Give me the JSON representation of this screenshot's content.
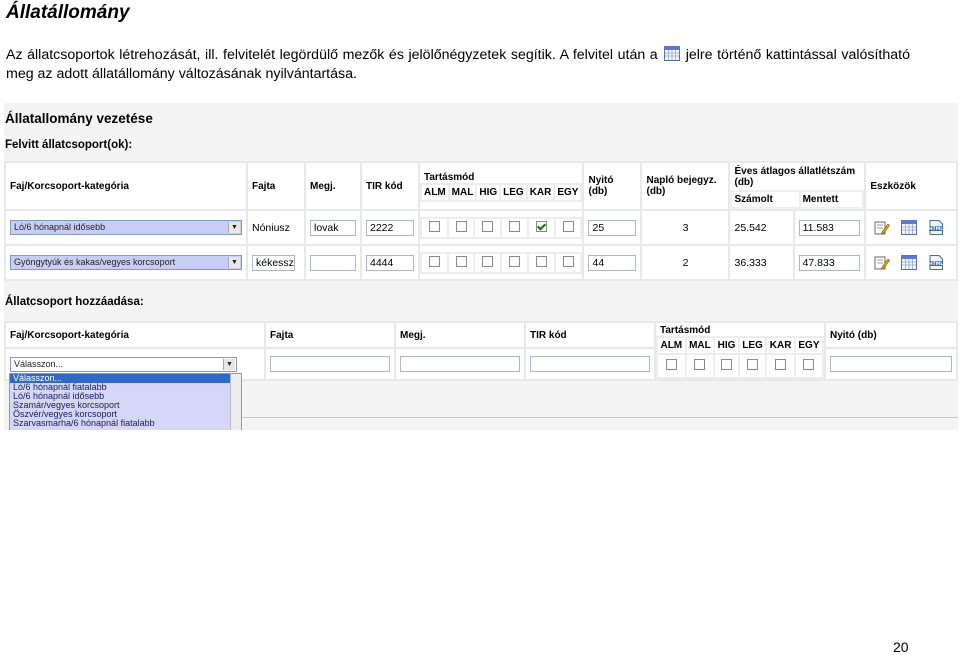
{
  "doc": {
    "title": "Állatállomány",
    "intro_part1": "Az állatcsoportok létrehozását, ill. felvitelét legördülő mezők és jelölőnégyzetek segítik. A felvitel után a",
    "intro_part2": "jelre történő kattintással valósítható meg az adott állatállomány változásának nyilvántartása.",
    "page_number": "20"
  },
  "screenshot": {
    "heading": "Állatallomány vezetése",
    "existing_heading": "Felvitt állatcsoport(ok):",
    "add_heading": "Állatcsoport hozzáadása:",
    "columns": {
      "category": "Faj/Korcsoport-kategória",
      "breed": "Fajta",
      "note": "Megj.",
      "tir": "TIR kód",
      "housing": "Tartásmód",
      "opening": "Nyitó (db)",
      "opening_two_line": [
        "Nyitó",
        "(db)"
      ],
      "log": "Napló bejegyz. (db)",
      "log_two_line": [
        "Napló bejegyz.",
        "(db)"
      ],
      "yearly": "Éves átlagos állatlétszám (db)",
      "yearly_two_line": [
        "Éves átlagos állatlétszám",
        "(db)"
      ],
      "calculated": "Számolt",
      "saved": "Mentett",
      "tools": "Eszközök"
    },
    "housing_codes": [
      "ALM",
      "MAL",
      "HIG",
      "LEG",
      "KAR",
      "EGY"
    ],
    "rows": [
      {
        "category": "Ló/6 hónapnál idősebb",
        "breed": "Nóniusz",
        "note": "lovak",
        "tir": "2222",
        "housing_checked": [
          false,
          false,
          false,
          false,
          true,
          false
        ],
        "opening": "25",
        "log": "3",
        "calculated": "25.542",
        "saved": "11.583"
      },
      {
        "category": "Gyöngytyúk és kakas/vegyes korcsoport",
        "breed": "kékesszü",
        "note": "",
        "tir": "4444",
        "housing_checked": [
          false,
          false,
          false,
          false,
          false,
          false
        ],
        "opening": "44",
        "log": "2",
        "calculated": "36.333",
        "saved": "47.833"
      }
    ],
    "add_form": {
      "category_selected": "Válasszon...",
      "dropdown_options": [
        "Válasszon...",
        "Ló/6 hónapnál fiatalabb",
        "Ló/6 hónapnál idősebb",
        "Szamár/vegyes korcsoport",
        "Öszvér/vegyes korcsoport",
        "Szarvasmarha/6 hónapnál fiatalabb"
      ]
    }
  }
}
